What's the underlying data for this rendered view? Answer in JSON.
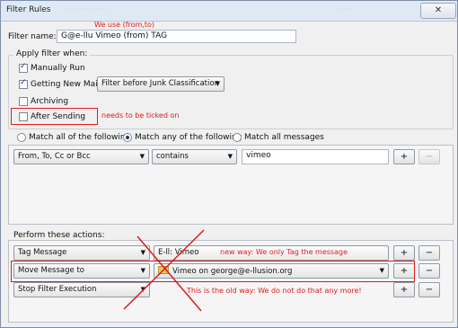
{
  "window": {
    "title": "Filter Rules",
    "ghost_left": "·· ··· ··· ··· ····",
    "ghost_right": "·· ·····",
    "close": "✕"
  },
  "annotations": {
    "top": "We use (from,to)",
    "after_sending": "needs to be ticked on",
    "new_way": "new way: We only Tag the message",
    "old_way": "This is the old way: We do not do that any more!"
  },
  "filter_name": {
    "label": "Filter name:",
    "value": "G@e-llu Vimeo (from) TAG"
  },
  "apply_when": {
    "heading": "Apply filter when:",
    "options": [
      {
        "label": "Manually Run",
        "checked": true
      },
      {
        "label": "Getting New Mail:",
        "checked": true
      },
      {
        "label": "Archiving",
        "checked": false
      },
      {
        "label": "After Sending",
        "checked": false
      }
    ],
    "new_mail_select": "Filter before Junk Classification"
  },
  "match": {
    "options": [
      "Match all of the following",
      "Match any of the following",
      "Match all messages"
    ],
    "selected": 1
  },
  "condition": {
    "field": "From, To, Cc or Bcc",
    "operator": "contains",
    "value": "vimeo",
    "add": "+",
    "remove": "−"
  },
  "actions": {
    "heading": "Perform these actions:",
    "rows": [
      {
        "action": "Tag Message",
        "target": "E-ll: Vimeo",
        "add": "+",
        "remove": "−"
      },
      {
        "action": "Move Message to",
        "target": "Vimeo on george@e-llusion.org",
        "add": "+",
        "remove": "−"
      },
      {
        "action": "Stop Filter Execution",
        "target": "",
        "add": "+",
        "remove": "−"
      }
    ]
  }
}
